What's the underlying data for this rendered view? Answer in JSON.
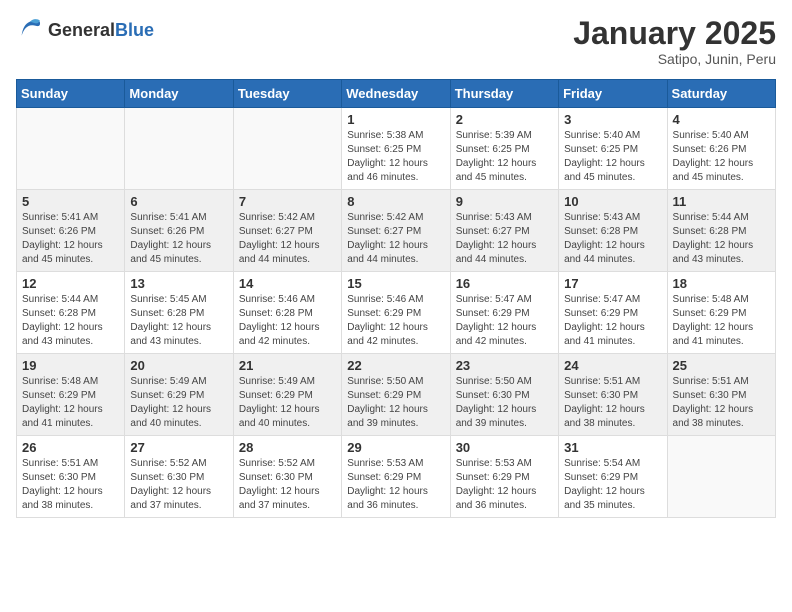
{
  "logo": {
    "general": "General",
    "blue": "Blue"
  },
  "header": {
    "month": "January 2025",
    "location": "Satipo, Junin, Peru"
  },
  "weekdays": [
    "Sunday",
    "Monday",
    "Tuesday",
    "Wednesday",
    "Thursday",
    "Friday",
    "Saturday"
  ],
  "weeks": [
    [
      {
        "day": "",
        "info": ""
      },
      {
        "day": "",
        "info": ""
      },
      {
        "day": "",
        "info": ""
      },
      {
        "day": "1",
        "info": "Sunrise: 5:38 AM\nSunset: 6:25 PM\nDaylight: 12 hours\nand 46 minutes."
      },
      {
        "day": "2",
        "info": "Sunrise: 5:39 AM\nSunset: 6:25 PM\nDaylight: 12 hours\nand 45 minutes."
      },
      {
        "day": "3",
        "info": "Sunrise: 5:40 AM\nSunset: 6:25 PM\nDaylight: 12 hours\nand 45 minutes."
      },
      {
        "day": "4",
        "info": "Sunrise: 5:40 AM\nSunset: 6:26 PM\nDaylight: 12 hours\nand 45 minutes."
      }
    ],
    [
      {
        "day": "5",
        "info": "Sunrise: 5:41 AM\nSunset: 6:26 PM\nDaylight: 12 hours\nand 45 minutes."
      },
      {
        "day": "6",
        "info": "Sunrise: 5:41 AM\nSunset: 6:26 PM\nDaylight: 12 hours\nand 45 minutes."
      },
      {
        "day": "7",
        "info": "Sunrise: 5:42 AM\nSunset: 6:27 PM\nDaylight: 12 hours\nand 44 minutes."
      },
      {
        "day": "8",
        "info": "Sunrise: 5:42 AM\nSunset: 6:27 PM\nDaylight: 12 hours\nand 44 minutes."
      },
      {
        "day": "9",
        "info": "Sunrise: 5:43 AM\nSunset: 6:27 PM\nDaylight: 12 hours\nand 44 minutes."
      },
      {
        "day": "10",
        "info": "Sunrise: 5:43 AM\nSunset: 6:28 PM\nDaylight: 12 hours\nand 44 minutes."
      },
      {
        "day": "11",
        "info": "Sunrise: 5:44 AM\nSunset: 6:28 PM\nDaylight: 12 hours\nand 43 minutes."
      }
    ],
    [
      {
        "day": "12",
        "info": "Sunrise: 5:44 AM\nSunset: 6:28 PM\nDaylight: 12 hours\nand 43 minutes."
      },
      {
        "day": "13",
        "info": "Sunrise: 5:45 AM\nSunset: 6:28 PM\nDaylight: 12 hours\nand 43 minutes."
      },
      {
        "day": "14",
        "info": "Sunrise: 5:46 AM\nSunset: 6:28 PM\nDaylight: 12 hours\nand 42 minutes."
      },
      {
        "day": "15",
        "info": "Sunrise: 5:46 AM\nSunset: 6:29 PM\nDaylight: 12 hours\nand 42 minutes."
      },
      {
        "day": "16",
        "info": "Sunrise: 5:47 AM\nSunset: 6:29 PM\nDaylight: 12 hours\nand 42 minutes."
      },
      {
        "day": "17",
        "info": "Sunrise: 5:47 AM\nSunset: 6:29 PM\nDaylight: 12 hours\nand 41 minutes."
      },
      {
        "day": "18",
        "info": "Sunrise: 5:48 AM\nSunset: 6:29 PM\nDaylight: 12 hours\nand 41 minutes."
      }
    ],
    [
      {
        "day": "19",
        "info": "Sunrise: 5:48 AM\nSunset: 6:29 PM\nDaylight: 12 hours\nand 41 minutes."
      },
      {
        "day": "20",
        "info": "Sunrise: 5:49 AM\nSunset: 6:29 PM\nDaylight: 12 hours\nand 40 minutes."
      },
      {
        "day": "21",
        "info": "Sunrise: 5:49 AM\nSunset: 6:29 PM\nDaylight: 12 hours\nand 40 minutes."
      },
      {
        "day": "22",
        "info": "Sunrise: 5:50 AM\nSunset: 6:29 PM\nDaylight: 12 hours\nand 39 minutes."
      },
      {
        "day": "23",
        "info": "Sunrise: 5:50 AM\nSunset: 6:30 PM\nDaylight: 12 hours\nand 39 minutes."
      },
      {
        "day": "24",
        "info": "Sunrise: 5:51 AM\nSunset: 6:30 PM\nDaylight: 12 hours\nand 38 minutes."
      },
      {
        "day": "25",
        "info": "Sunrise: 5:51 AM\nSunset: 6:30 PM\nDaylight: 12 hours\nand 38 minutes."
      }
    ],
    [
      {
        "day": "26",
        "info": "Sunrise: 5:51 AM\nSunset: 6:30 PM\nDaylight: 12 hours\nand 38 minutes."
      },
      {
        "day": "27",
        "info": "Sunrise: 5:52 AM\nSunset: 6:30 PM\nDaylight: 12 hours\nand 37 minutes."
      },
      {
        "day": "28",
        "info": "Sunrise: 5:52 AM\nSunset: 6:30 PM\nDaylight: 12 hours\nand 37 minutes."
      },
      {
        "day": "29",
        "info": "Sunrise: 5:53 AM\nSunset: 6:29 PM\nDaylight: 12 hours\nand 36 minutes."
      },
      {
        "day": "30",
        "info": "Sunrise: 5:53 AM\nSunset: 6:29 PM\nDaylight: 12 hours\nand 36 minutes."
      },
      {
        "day": "31",
        "info": "Sunrise: 5:54 AM\nSunset: 6:29 PM\nDaylight: 12 hours\nand 35 minutes."
      },
      {
        "day": "",
        "info": ""
      }
    ]
  ]
}
